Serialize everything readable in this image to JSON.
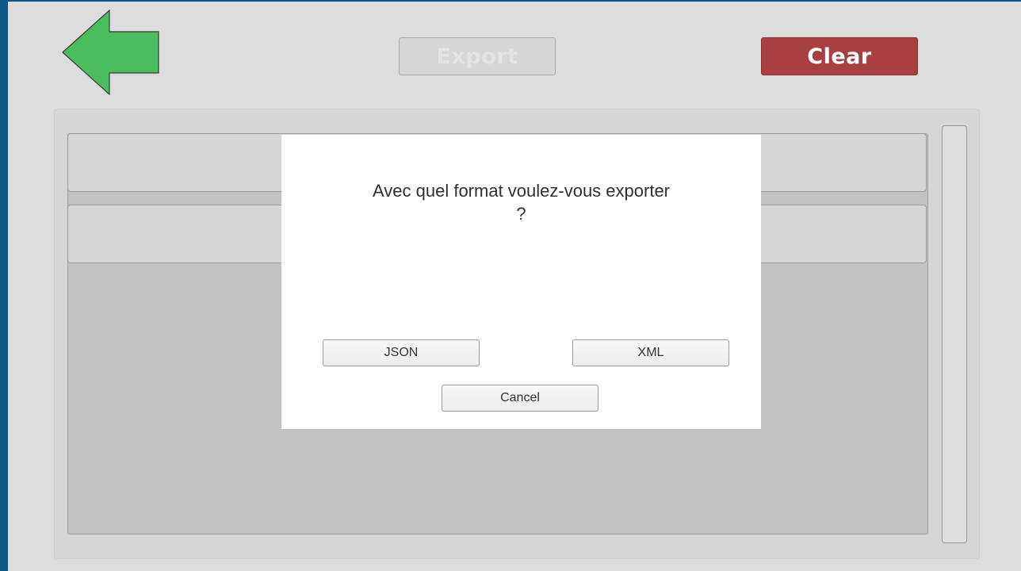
{
  "toolbar": {
    "back_icon": "back-arrow-icon",
    "back_color": "#4cbd5f",
    "export_label": "Export",
    "export_enabled": false,
    "clear_label": "Clear",
    "clear_color": "#a8403f"
  },
  "dialog": {
    "message": "Avec quel format voulez-vous exporter ?",
    "json_label": "JSON",
    "xml_label": "XML",
    "cancel_label": "Cancel"
  }
}
